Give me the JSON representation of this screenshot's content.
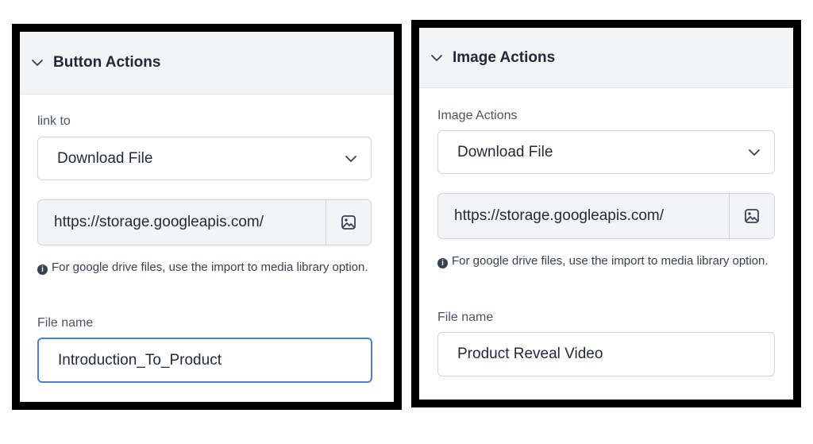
{
  "left_panel": {
    "title": "Button Actions",
    "link_label": "link to",
    "link_value": "Download File",
    "url_value": "https://storage.googleapis.com/",
    "hint_text": "For google drive files, use the import to media library option.",
    "file_name_label": "File name",
    "file_name_value": "Introduction_To_Product"
  },
  "right_panel": {
    "title": "Image Actions",
    "link_label": "Image Actions",
    "link_value": "Download File",
    "url_value": "https://storage.googleapis.com/",
    "hint_text": "For google drive files, use the import to media library option.",
    "file_name_label": "File name",
    "file_name_value": "Product Reveal Video"
  },
  "icons": {
    "collapse": "chevron-down-icon",
    "select_caret": "chevron-down-icon",
    "media": "image-icon",
    "info": "info-icon"
  },
  "colors": {
    "focus_border": "#4a7fd4",
    "header_bg": "#f3f4f6"
  }
}
